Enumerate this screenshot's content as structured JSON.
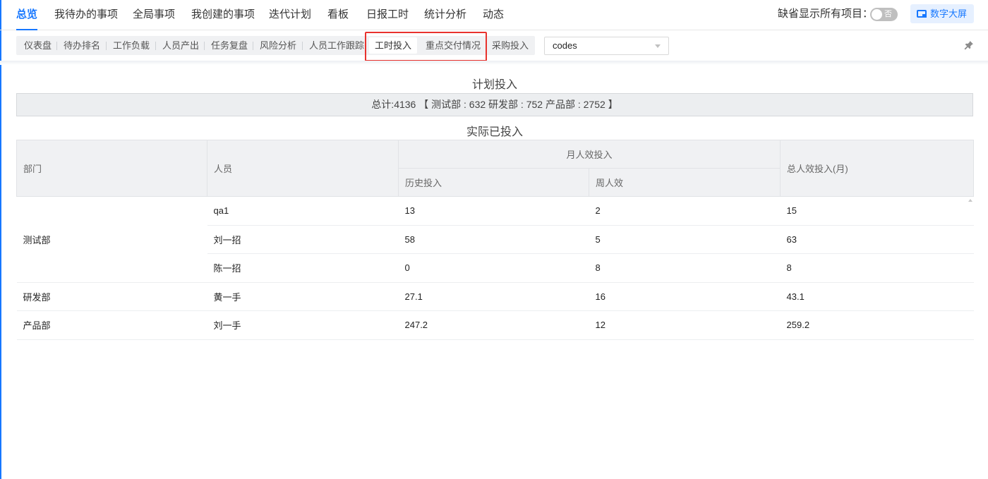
{
  "topnav": {
    "tabs": [
      {
        "label": "总览",
        "active": true
      },
      {
        "label": "我待办的事项"
      },
      {
        "label": "全局事项"
      },
      {
        "label": "我创建的事项"
      },
      {
        "label": "迭代计划"
      },
      {
        "label": "看板"
      },
      {
        "label": "日报工时"
      },
      {
        "label": "统计分析"
      },
      {
        "label": "动态"
      }
    ],
    "default_show_label": "缺省显示所有项目：",
    "toggle_text": "否",
    "big_screen_label": "数字大屏"
  },
  "subtabs": {
    "items": [
      {
        "label": "仪表盘"
      },
      {
        "label": "待办排名"
      },
      {
        "label": "工作负载"
      },
      {
        "label": "人员产出"
      },
      {
        "label": "任务复盘"
      },
      {
        "label": "风险分析"
      },
      {
        "label": "人员工作跟踪"
      },
      {
        "label": "工时投入",
        "selected": true
      },
      {
        "label": "重点交付情况"
      },
      {
        "label": "采购投入"
      }
    ]
  },
  "project_select": {
    "value": "codes"
  },
  "plan": {
    "title": "计划投入",
    "total_text": "总计:4136 【 测试部 : 632  研发部 : 752  产品部 : 2752 】"
  },
  "actual": {
    "title": "实际已投入",
    "headers": {
      "dept": "部门",
      "person": "人员",
      "monthly": "月人效投入",
      "history": "历史投入",
      "weekly": "周人效",
      "total": "总人效投入(月)"
    },
    "groups": [
      {
        "dept": "测试部",
        "rows": [
          {
            "person": "qa1",
            "history": "13",
            "weekly": "2",
            "total": "15"
          },
          {
            "person": "刘一招",
            "history": "58",
            "weekly": "5",
            "total": "63"
          },
          {
            "person": "陈一招",
            "history": "0",
            "weekly": "8",
            "total": "8"
          }
        ]
      },
      {
        "dept": "研发部",
        "rows": [
          {
            "person": "黄一手",
            "history": "27.1",
            "weekly": "16",
            "total": "43.1"
          }
        ]
      },
      {
        "dept": "产品部",
        "rows": [
          {
            "person": "刘一手",
            "history": "247.2",
            "weekly": "12",
            "total": "259.2"
          }
        ]
      }
    ]
  },
  "colors": {
    "accent": "#1677ff",
    "highlight": "#e8322d"
  }
}
